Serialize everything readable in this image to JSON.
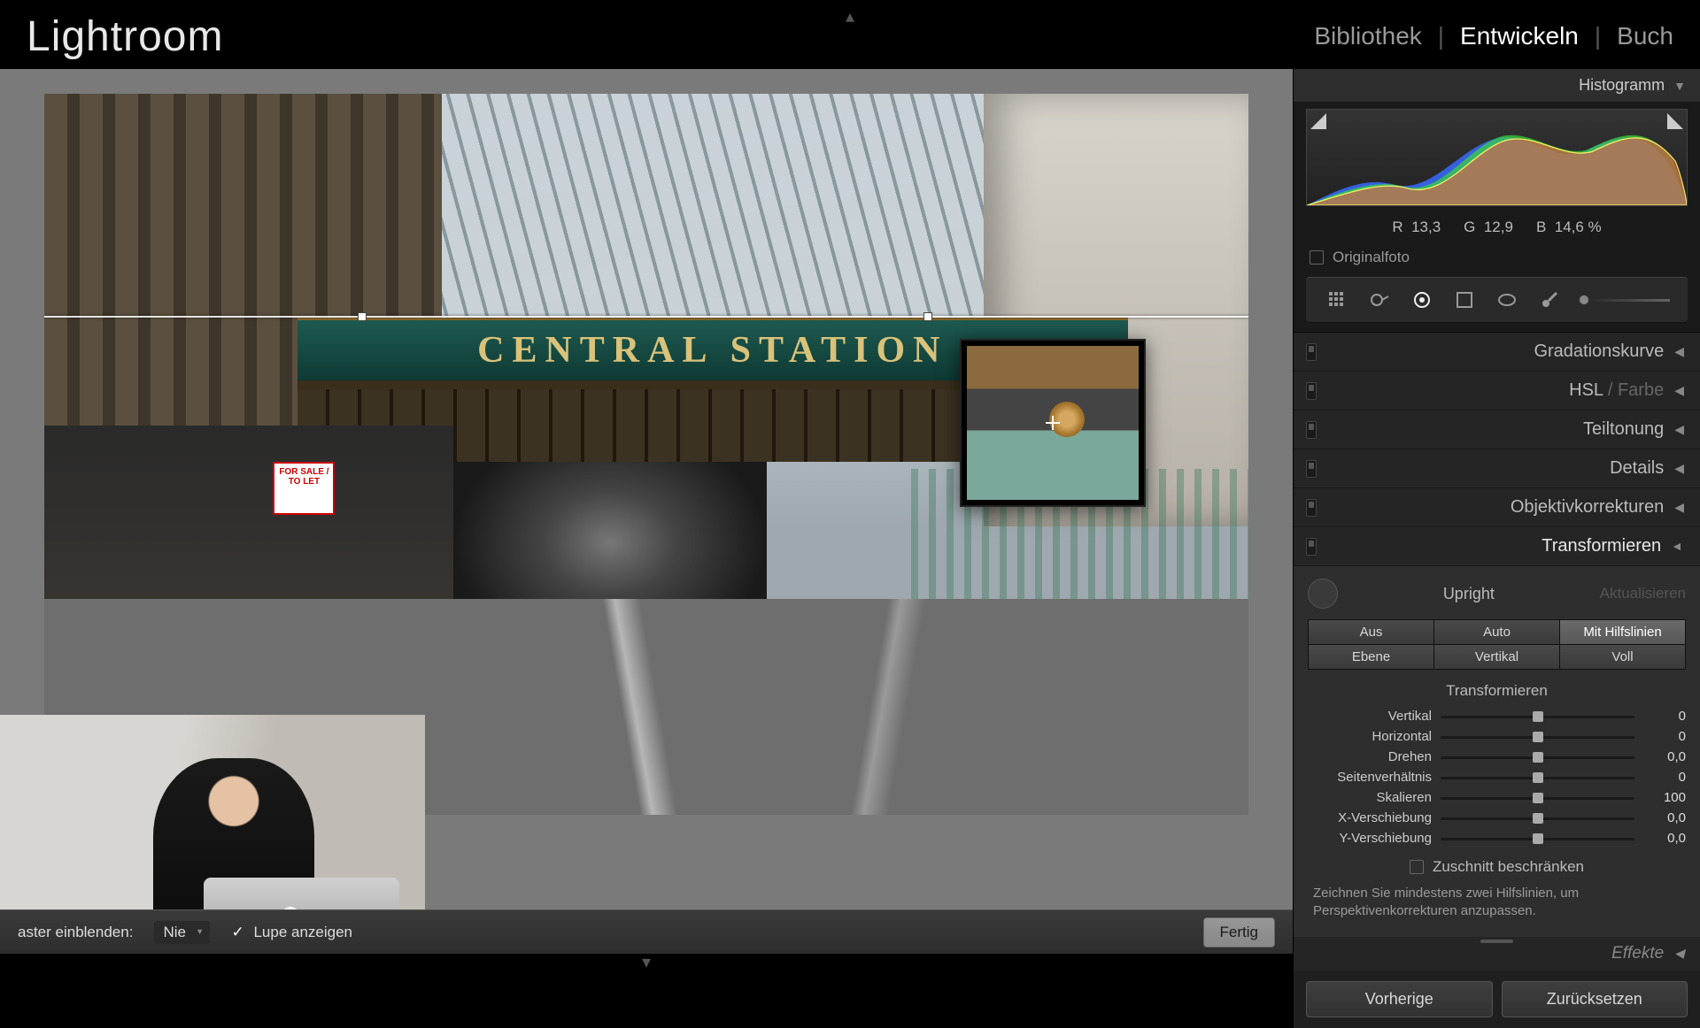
{
  "app": {
    "title": "Lightroom"
  },
  "modules": {
    "library": "Bibliothek",
    "develop": "Entwickeln",
    "book": "Buch",
    "active": "develop"
  },
  "photo": {
    "sign_text": "CENTRAL STATION",
    "for_sale_text": "FOR SALE / TO LET"
  },
  "histogram": {
    "header": "Histogramm",
    "rgb": {
      "r_label": "R",
      "r": "13,3",
      "g_label": "G",
      "g": "12,9",
      "b_label": "B",
      "b": "14,6 %"
    },
    "original_label": "Originalfoto",
    "original_checked": false
  },
  "toolstrip": {
    "crop": "crop",
    "spot": "spot",
    "redeye": "redeye",
    "gradient": "gradient",
    "radial": "radial",
    "brush": "brush"
  },
  "panels": {
    "tone_curve": "Gradationskurve",
    "hsl_a": "HSL",
    "hsl_sep": " / ",
    "hsl_b": "Farbe",
    "split": "Teiltonung",
    "detail": "Details",
    "lens": "Objektivkorrekturen",
    "transform": "Transformieren",
    "effects": "Effekte"
  },
  "transform": {
    "upright_label": "Upright",
    "update_label": "Aktualisieren",
    "segments": {
      "off": "Aus",
      "auto": "Auto",
      "guided": "Mit Hilfslinien",
      "level": "Ebene",
      "vertical": "Vertikal",
      "full": "Voll"
    },
    "selected_segment": "guided",
    "section_title": "Transformieren",
    "sliders": [
      {
        "key": "vertical",
        "label": "Vertikal",
        "value": "0",
        "pos": 50
      },
      {
        "key": "horizontal",
        "label": "Horizontal",
        "value": "0",
        "pos": 50
      },
      {
        "key": "rotate",
        "label": "Drehen",
        "value": "0,0",
        "pos": 50
      },
      {
        "key": "aspect",
        "label": "Seitenverhältnis",
        "value": "0",
        "pos": 50
      },
      {
        "key": "scale",
        "label": "Skalieren",
        "value": "100",
        "pos": 50
      },
      {
        "key": "xoffset",
        "label": "X-Verschiebung",
        "value": "0,0",
        "pos": 50
      },
      {
        "key": "yoffset",
        "label": "Y-Verschiebung",
        "value": "0,0",
        "pos": 50
      }
    ],
    "constrain_crop": "Zuschnitt beschränken",
    "constrain_checked": false,
    "hint": "Zeichnen Sie mindestens zwei Hilfslinien, um Perspektivenkorrekturen anzupassen."
  },
  "tool_options": {
    "grid_label": "aster einblenden:",
    "grid_value": "Nie",
    "loupe_label": "Lupe anzeigen",
    "loupe_checked": true,
    "done": "Fertig"
  },
  "footer": {
    "previous": "Vorherige",
    "reset": "Zurücksetzen"
  }
}
